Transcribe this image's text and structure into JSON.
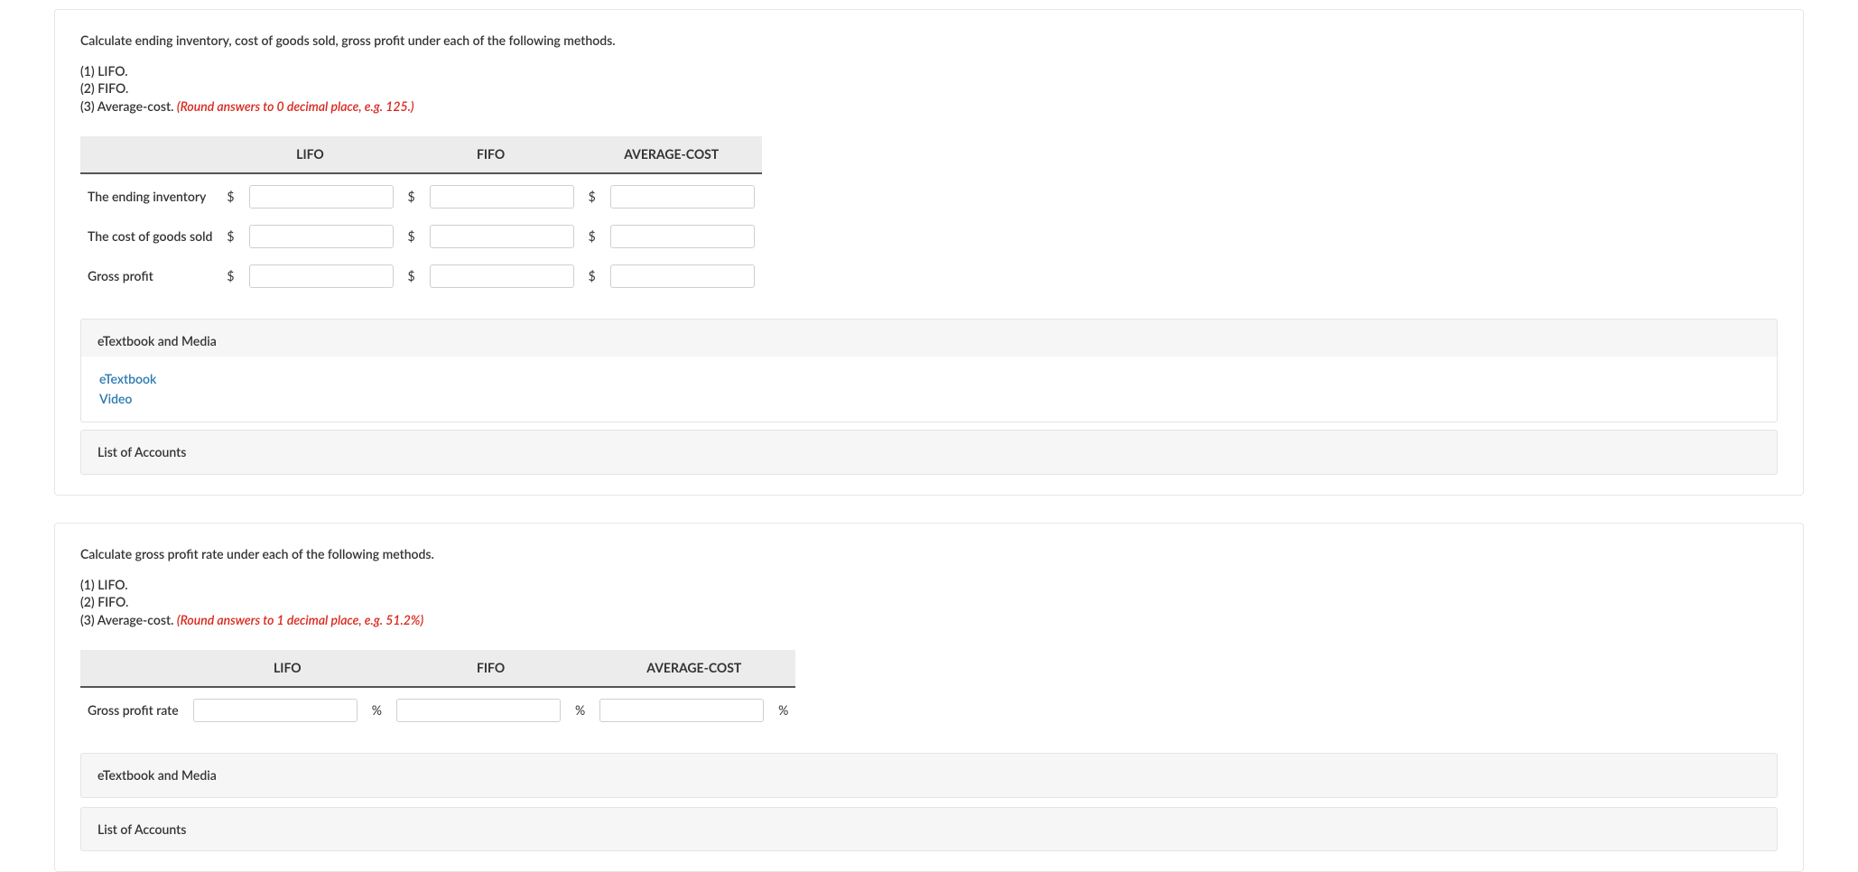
{
  "part1": {
    "prompt": "Calculate ending inventory, cost of goods sold, gross profit under each of the following methods.",
    "line1": "(1) LIFO.",
    "line2": "(2) FIFO.",
    "line3_lead": "(3) Average-cost. ",
    "line3_hint": "(Round answers to 0 decimal place, e.g. 125.)",
    "cols": {
      "c1": "LIFO",
      "c2": "FIFO",
      "c3": "AVERAGE-COST"
    },
    "rows": {
      "r1": "The ending inventory",
      "r2": "The cost of goods sold",
      "r3": "Gross profit"
    },
    "currency": "$",
    "media_header": "eTextbook and Media",
    "media_link1": "eTextbook",
    "media_link2": "Video",
    "accounts_header": "List of Accounts"
  },
  "part2": {
    "prompt": "Calculate gross profit rate under each of the following methods.",
    "line1": "(1) LIFO.",
    "line2": "(2) FIFO.",
    "line3_lead": "(3) Average-cost. ",
    "line3_hint": "(Round answers to 1 decimal place, e.g. 51.2%)",
    "cols": {
      "c1": "LIFO",
      "c2": "FIFO",
      "c3": "AVERAGE-COST"
    },
    "rows": {
      "r1": "Gross profit rate"
    },
    "suffix": "%",
    "media_header": "eTextbook and Media",
    "accounts_header": "List of Accounts"
  }
}
